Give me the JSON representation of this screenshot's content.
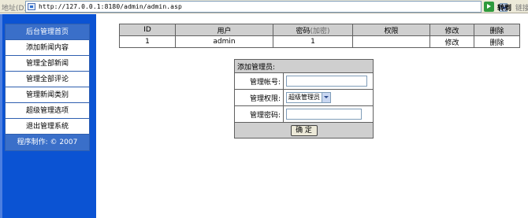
{
  "address_bar": {
    "label": "地址(D)",
    "url": "http://127.0.0.1:8180/admin/admin.asp",
    "go_label": "转到",
    "links_label": "链接"
  },
  "sidebar": {
    "header": "后台管理首页",
    "items": [
      "添加新闻内容",
      "管理全部新闻",
      "管理全部评论",
      "管理新闻类别",
      "超级管理选项",
      "退出管理系统"
    ],
    "footer": "程序制作: © 2007"
  },
  "admin_table": {
    "columns": [
      "ID",
      "用户",
      "密码",
      "(加密)",
      "权限",
      "修改",
      "删除"
    ],
    "rows": [
      {
        "id": "1",
        "user": "admin",
        "password": "1",
        "permission": "",
        "edit": "修改",
        "delete": "删除"
      }
    ]
  },
  "add_admin_form": {
    "title": "添加管理员:",
    "account_label": "管理帐号:",
    "account_value": "",
    "permission_label": "管理权限:",
    "permission_selected": "超级管理员",
    "password_label": "管理密码:",
    "password_value": "",
    "submit_label": "确 定"
  },
  "colors": {
    "sidebar_bg": "#0b53d3",
    "menu_header_bg": "#3a6fc9",
    "table_header_bg": "#cfcfcf"
  }
}
